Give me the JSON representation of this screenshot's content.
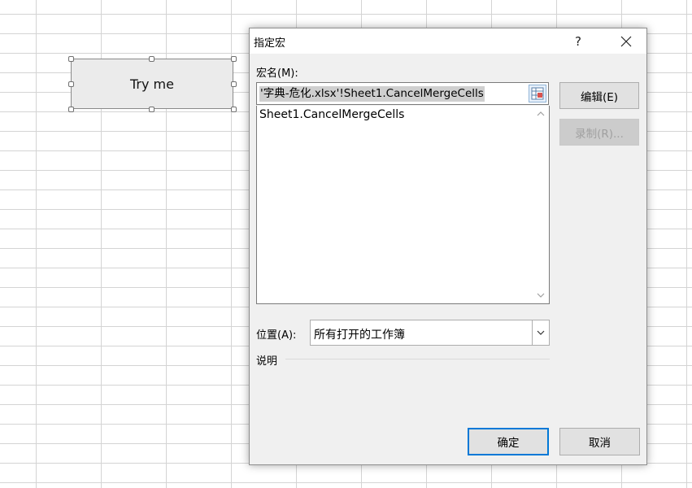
{
  "sheet": {
    "button_label": "Try me"
  },
  "dialog": {
    "title": "指定宏",
    "help_label": "?",
    "close_icon": "close-icon",
    "macro_name_label": "宏名(M):",
    "macro_name_value": "'字典-危化.xlsx'!Sheet1.CancelMergeCells",
    "macro_list": [
      "Sheet1.CancelMergeCells"
    ],
    "buttons": {
      "edit": "编辑(E)",
      "record": "录制(R)...",
      "ok": "确定",
      "cancel": "取消"
    },
    "location_label": "位置(A):",
    "location_value": "所有打开的工作簿",
    "description_label": "说明"
  },
  "colors": {
    "accent": "#0078d7",
    "dialog_bg": "#f0f0f0",
    "grid": "#d4d4d4"
  }
}
